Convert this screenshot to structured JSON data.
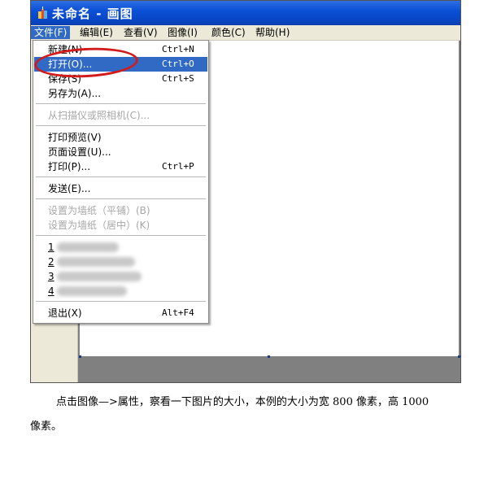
{
  "window": {
    "title": "未命名 - 画图"
  },
  "menubar": {
    "items": [
      "文件(F)",
      "编辑(E)",
      "查看(V)",
      "图像(I)",
      "颜色(C)",
      "帮助(H)"
    ]
  },
  "file_menu": {
    "items": [
      {
        "label": "新建(N)",
        "shortcut": "Ctrl+N"
      },
      {
        "label": "打开(O)...",
        "shortcut": "Ctrl+O"
      },
      {
        "label": "保存(S)",
        "shortcut": "Ctrl+S"
      },
      {
        "label": "另存为(A)...",
        "shortcut": ""
      },
      {
        "label": "从扫描仪或照相机(C)...",
        "shortcut": ""
      },
      {
        "label": "打印预览(V)",
        "shortcut": ""
      },
      {
        "label": "页面设置(U)...",
        "shortcut": ""
      },
      {
        "label": "打印(P)...",
        "shortcut": "Ctrl+P"
      },
      {
        "label": "发送(E)...",
        "shortcut": ""
      },
      {
        "label": "设置为墙纸（平铺）(B)",
        "shortcut": ""
      },
      {
        "label": "设置为墙纸（居中）(K)",
        "shortcut": ""
      },
      {
        "label": "1",
        "shortcut": ""
      },
      {
        "label": "2",
        "shortcut": ""
      },
      {
        "label": "3",
        "shortcut": ""
      },
      {
        "label": "4",
        "shortcut": ""
      },
      {
        "label": "退出(X)",
        "shortcut": "Alt+F4"
      }
    ]
  },
  "caption": {
    "line1": "点击图像—>属性，察看一下图片的大小，本例的大小为宽 800 像素，高 1000",
    "line2": "像素。"
  },
  "colors": {
    "titlebar": "#0a50d8",
    "highlight": "#316ac5",
    "annotation": "#d21c1c",
    "workspace": "#808080"
  }
}
